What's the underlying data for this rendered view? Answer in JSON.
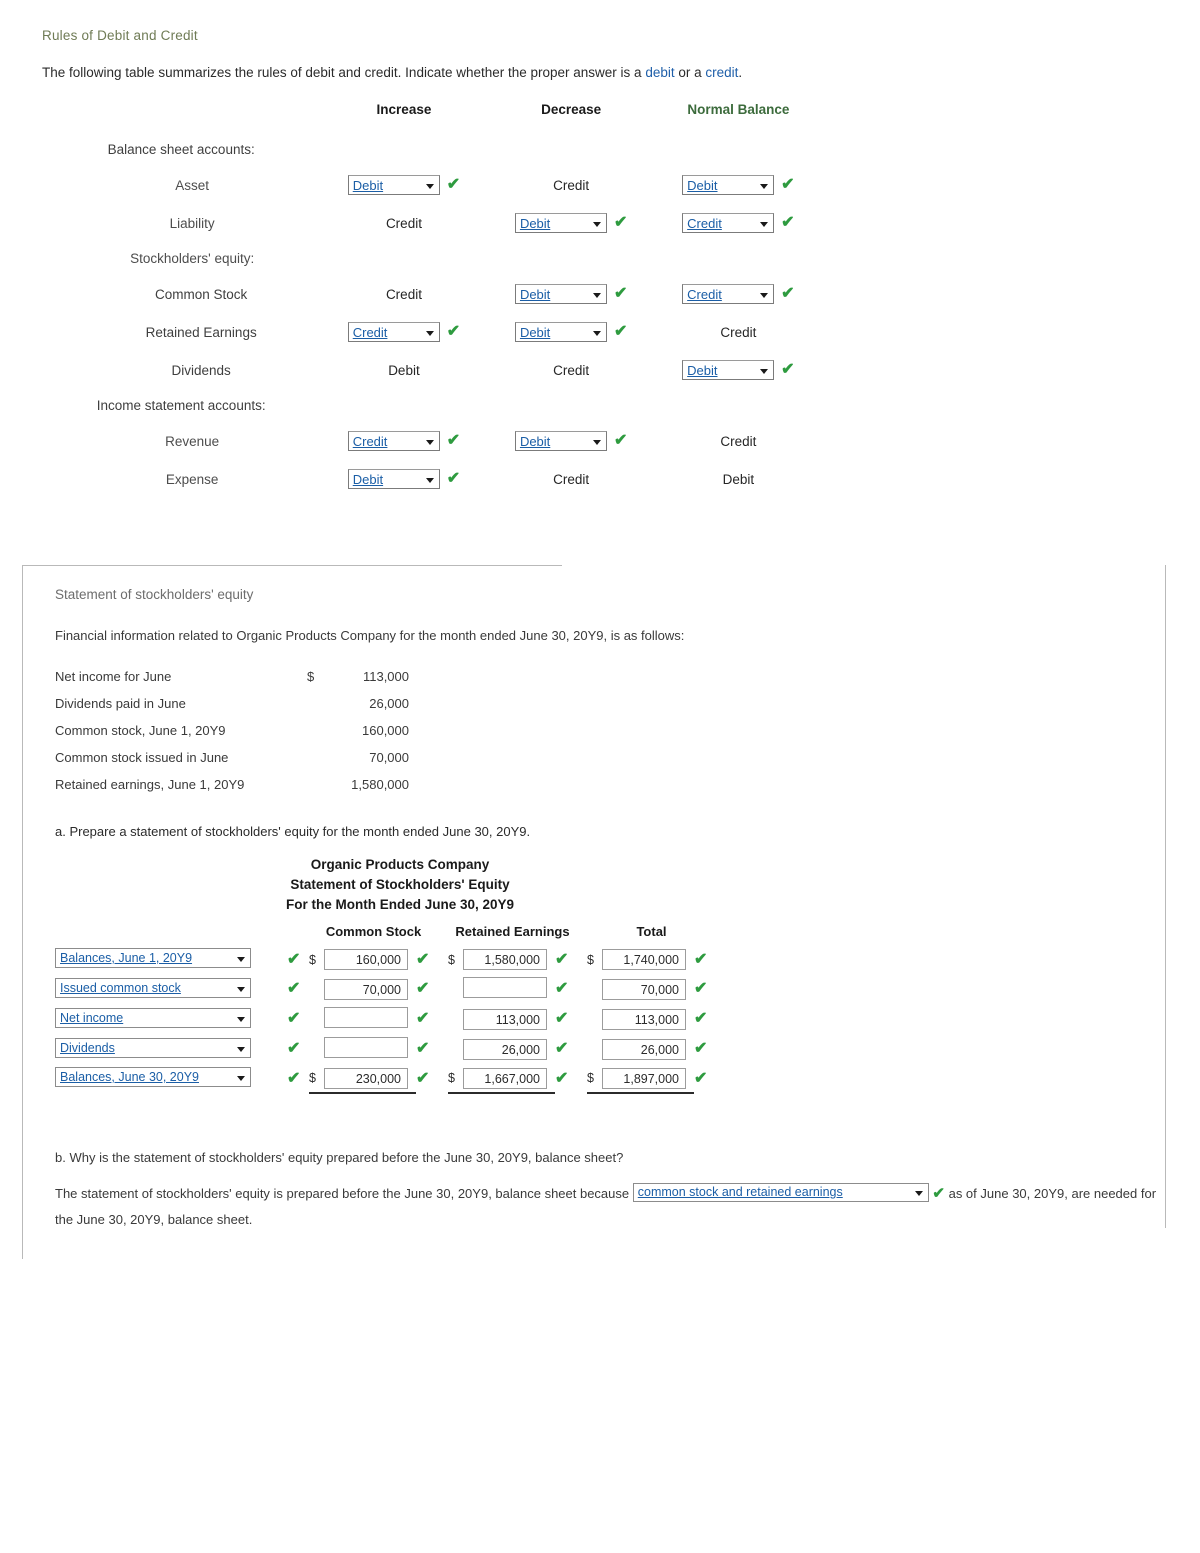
{
  "section1": {
    "title": "Rules of Debit and Credit",
    "intro_before": "The following table summarizes the rules of debit and credit. Indicate whether the proper answer is a ",
    "intro_kw1": "debit",
    "intro_mid": " or a ",
    "intro_kw2": "credit",
    "intro_after": ".",
    "headers": [
      "",
      "Increase",
      "Decrease",
      "Normal Balance"
    ],
    "rows": [
      {
        "label": "Balance sheet accounts:",
        "level": "grp",
        "increase": null,
        "decrease": null,
        "normal": null
      },
      {
        "label": "Asset",
        "level": "lvl1",
        "increase": {
          "type": "select",
          "value": "Debit",
          "checked": true
        },
        "decrease": {
          "type": "text",
          "value": "Credit",
          "checked": false
        },
        "normal": {
          "type": "select",
          "value": "Debit",
          "checked": true
        }
      },
      {
        "label": "Liability",
        "level": "lvl1",
        "increase": {
          "type": "text",
          "value": "Credit",
          "checked": false
        },
        "decrease": {
          "type": "select",
          "value": "Debit",
          "checked": true
        },
        "normal": {
          "type": "select",
          "value": "Credit",
          "checked": true
        }
      },
      {
        "label": "Stockholders' equity:",
        "level": "lvl1",
        "increase": null,
        "decrease": null,
        "normal": null
      },
      {
        "label": "Common Stock",
        "level": "lvl2",
        "increase": {
          "type": "text",
          "value": "Credit",
          "checked": false
        },
        "decrease": {
          "type": "select",
          "value": "Debit",
          "checked": true
        },
        "normal": {
          "type": "select",
          "value": "Credit",
          "checked": true
        }
      },
      {
        "label": "Retained Earnings",
        "level": "lvl2",
        "increase": {
          "type": "select",
          "value": "Credit",
          "checked": true
        },
        "decrease": {
          "type": "select",
          "value": "Debit",
          "checked": true
        },
        "normal": {
          "type": "text",
          "value": "Credit",
          "checked": false
        }
      },
      {
        "label": "Dividends",
        "level": "lvl2",
        "increase": {
          "type": "text",
          "value": "Debit",
          "checked": false
        },
        "decrease": {
          "type": "text",
          "value": "Credit",
          "checked": false
        },
        "normal": {
          "type": "select",
          "value": "Debit",
          "checked": true
        }
      },
      {
        "label": "Income statement accounts:",
        "level": "grp",
        "increase": null,
        "decrease": null,
        "normal": null
      },
      {
        "label": "Revenue",
        "level": "lvl1",
        "increase": {
          "type": "select",
          "value": "Credit",
          "checked": true
        },
        "decrease": {
          "type": "select",
          "value": "Debit",
          "checked": true
        },
        "normal": {
          "type": "text",
          "value": "Credit",
          "checked": false
        }
      },
      {
        "label": "Expense",
        "level": "lvl1",
        "increase": {
          "type": "select",
          "value": "Debit",
          "checked": true
        },
        "decrease": {
          "type": "text",
          "value": "Credit",
          "checked": false
        },
        "normal": {
          "type": "text",
          "value": "Debit",
          "checked": false
        }
      }
    ],
    "select_options": [
      "Debit",
      "Credit"
    ]
  },
  "section2": {
    "title": "Statement of stockholders' equity",
    "intro": "Financial information related to Organic Products Company for the month ended June 30, 20Y9, is as follows:",
    "facts": [
      {
        "label": "Net income for June",
        "dollar": "$",
        "amount": "113,000"
      },
      {
        "label": "Dividends paid in June",
        "dollar": "",
        "amount": "26,000"
      },
      {
        "label": "Common stock, June 1, 20Y9",
        "dollar": "",
        "amount": "160,000"
      },
      {
        "label": "Common stock issued in June",
        "dollar": "",
        "amount": "70,000"
      },
      {
        "label": "Retained earnings, June 1, 20Y9",
        "dollar": "",
        "amount": "1,580,000"
      }
    ],
    "question_a": "a. Prepare a statement of stockholders' equity for the month ended June 30, 20Y9.",
    "statement_heading": [
      "Organic Products Company",
      "Statement of Stockholders' Equity",
      "For the Month Ended June 30, 20Y9"
    ],
    "table_headers": [
      "Common Stock",
      "Retained Earnings",
      "Total"
    ],
    "table_rows": [
      {
        "label": {
          "type": "select",
          "value": "Balances, June 1, 20Y9",
          "checked": true
        },
        "common_stock": {
          "dollar": "$",
          "value": "160,000",
          "checked": true
        },
        "retained_earnings": {
          "dollar": "$",
          "value": "1,580,000",
          "checked": true
        },
        "total": {
          "dollar": "$",
          "value": "1,740,000",
          "checked": true
        },
        "total_row": false
      },
      {
        "label": {
          "type": "select",
          "value": "Issued common stock",
          "checked": true
        },
        "common_stock": {
          "dollar": "",
          "value": "70,000",
          "checked": true
        },
        "retained_earnings": {
          "dollar": "",
          "value": "",
          "checked": true
        },
        "total": {
          "dollar": "",
          "value": "70,000",
          "checked": true
        },
        "total_row": false
      },
      {
        "label": {
          "type": "select",
          "value": "Net income",
          "checked": true
        },
        "common_stock": {
          "dollar": "",
          "value": "",
          "checked": true
        },
        "retained_earnings": {
          "dollar": "",
          "value": "113,000",
          "checked": true
        },
        "total": {
          "dollar": "",
          "value": "113,000",
          "checked": true
        },
        "total_row": false
      },
      {
        "label": {
          "type": "select",
          "value": "Dividends",
          "checked": true
        },
        "common_stock": {
          "dollar": "",
          "value": "",
          "checked": true
        },
        "retained_earnings": {
          "dollar": "",
          "value": "26,000",
          "checked": true
        },
        "total": {
          "dollar": "",
          "value": "26,000",
          "checked": true
        },
        "total_row": false
      },
      {
        "label": {
          "type": "select",
          "value": "Balances, June 30, 20Y9",
          "checked": true
        },
        "common_stock": {
          "dollar": "$",
          "value": "230,000",
          "checked": true
        },
        "retained_earnings": {
          "dollar": "$",
          "value": "1,667,000",
          "checked": true
        },
        "total": {
          "dollar": "$",
          "value": "1,897,000",
          "checked": true
        },
        "total_row": true
      }
    ],
    "question_b": "b. Why is the statement of stockholders' equity prepared before the June 30, 20Y9, balance sheet?",
    "answer_b_before": "The statement of stockholders' equity is prepared before the June 30, 20Y9, balance sheet because",
    "answer_b_select": "common stock and retained earnings",
    "answer_b_after": "as of June 30, 20Y9, are needed for the June 30, 20Y9, balance sheet.",
    "checkmark": "✔",
    "row_select_options": [
      "Balances, June 1, 20Y9",
      "Issued common stock",
      "Net income",
      "Dividends",
      "Balances, June 30, 20Y9"
    ],
    "answer_b_options": [
      "common stock and retained earnings"
    ]
  },
  "colors": {
    "link_blue": "#1b5ea6",
    "check_green": "#2e9b3f",
    "heading_green": "#3c6b3c",
    "title_olive": "#6f7b55",
    "rule_gray": "#b9b9b9"
  }
}
